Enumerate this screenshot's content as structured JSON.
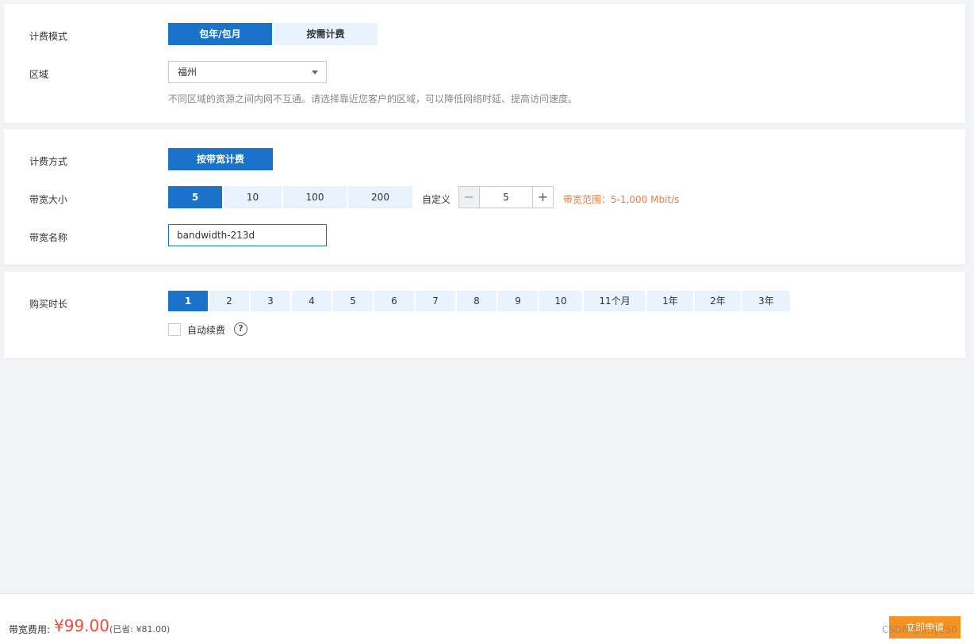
{
  "billing": {
    "mode_label": "计费模式",
    "mode_options": [
      "包年/包月",
      "按需计费"
    ],
    "region_label": "区域",
    "region_value": "福州",
    "region_hint": "不同区域的资源之间内网不互通。请选择靠近您客户的区域，可以降低网络时延、提高访问速度。"
  },
  "bandwidth": {
    "method_label": "计费方式",
    "method_value": "按带宽计费",
    "size_label": "带宽大小",
    "size_options": [
      "5",
      "10",
      "100",
      "200"
    ],
    "custom_label": "自定义",
    "custom_value": "5",
    "minus": "−",
    "plus": "+",
    "range_hint": "带宽范围：5-1,000 Mbit/s",
    "name_label": "带宽名称",
    "name_value": "bandwidth-213d"
  },
  "duration": {
    "label": "购买时长",
    "options": [
      "1",
      "2",
      "3",
      "4",
      "5",
      "6",
      "7",
      "8",
      "9",
      "10",
      "11个月",
      "1年",
      "2年",
      "3年"
    ],
    "auto_renew_label": "自动续费",
    "help": "?"
  },
  "footer": {
    "fee_label": "带宽费用:",
    "price": "¥99.00",
    "saved": "(已省: ¥81.00)",
    "buy_button": "立即申请",
    "watermark": "CSDN @lmy250"
  },
  "colors": {
    "primary": "#1a73c9",
    "segment_bg": "#e9f3fd",
    "price_red": "#f04a3c",
    "range_orange": "#f07b3f",
    "buy_orange": "#f7921e"
  }
}
